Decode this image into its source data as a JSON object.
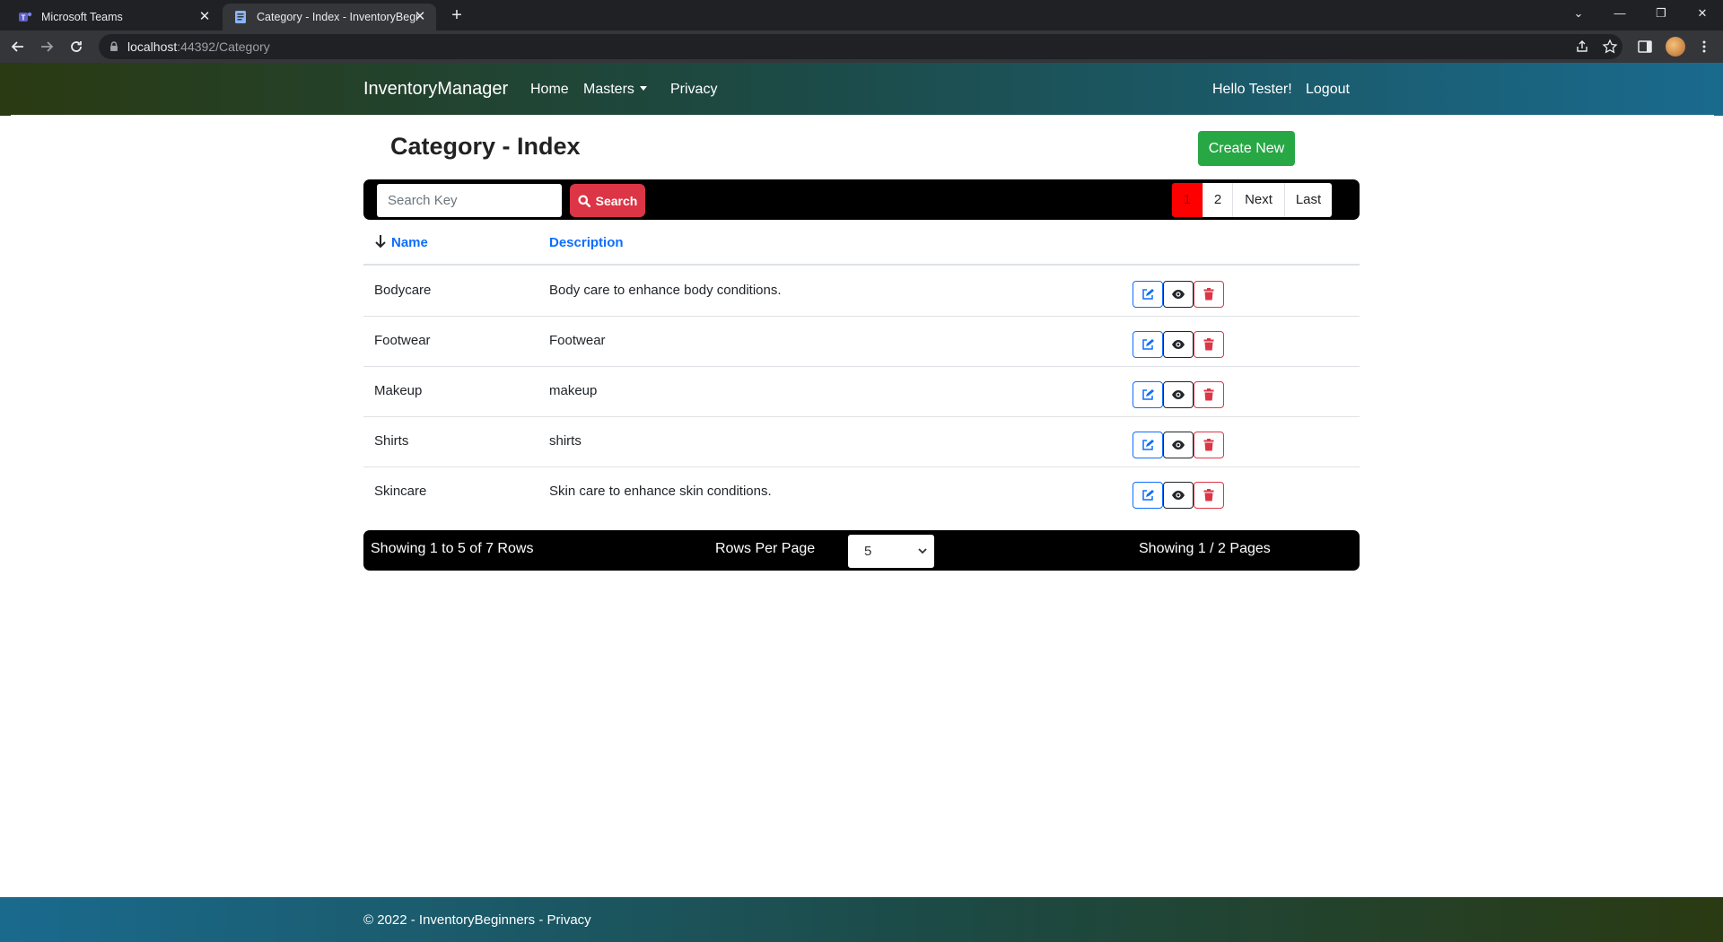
{
  "browser": {
    "tabs": [
      {
        "title": "Microsoft Teams",
        "active": false
      },
      {
        "title": "Category - Index - InventoryBeginners",
        "active": true
      }
    ],
    "url_host": "localhost",
    "url_rest": ":44392/Category"
  },
  "navbar": {
    "brand": "InventoryManager",
    "links": [
      "Home",
      "Masters",
      "Privacy"
    ],
    "greeting": "Hello Tester!",
    "logout": "Logout"
  },
  "page": {
    "title": "Category - Index",
    "create_button": "Create New"
  },
  "search": {
    "placeholder": "Search Key",
    "button": "Search"
  },
  "pager": {
    "pages": [
      "1",
      "2"
    ],
    "current": "1",
    "next": "Next",
    "last": "Last"
  },
  "table": {
    "columns": [
      "Name",
      "Description"
    ],
    "sort_indicator": "arrow-down-icon",
    "rows": [
      {
        "name": "Bodycare",
        "description": "Body care to enhance body conditions."
      },
      {
        "name": "Footwear",
        "description": "Footwear"
      },
      {
        "name": "Makeup",
        "description": "makeup"
      },
      {
        "name": "Shirts",
        "description": "shirts"
      },
      {
        "name": "Skincare",
        "description": "Skin care to enhance skin conditions."
      }
    ]
  },
  "summary": {
    "rows_text": "Showing 1 to 5 of 7 Rows",
    "rows_per_page_label": "Rows Per Page",
    "rows_per_page_value": "5",
    "pages_text": "Showing 1 / 2 Pages"
  },
  "footer": {
    "text": "© 2022 - InventoryBeginners - Privacy"
  },
  "colors": {
    "create": "#28a745",
    "search": "#dc3545",
    "active_page": "#ff0000",
    "link": "#0d6efd"
  }
}
